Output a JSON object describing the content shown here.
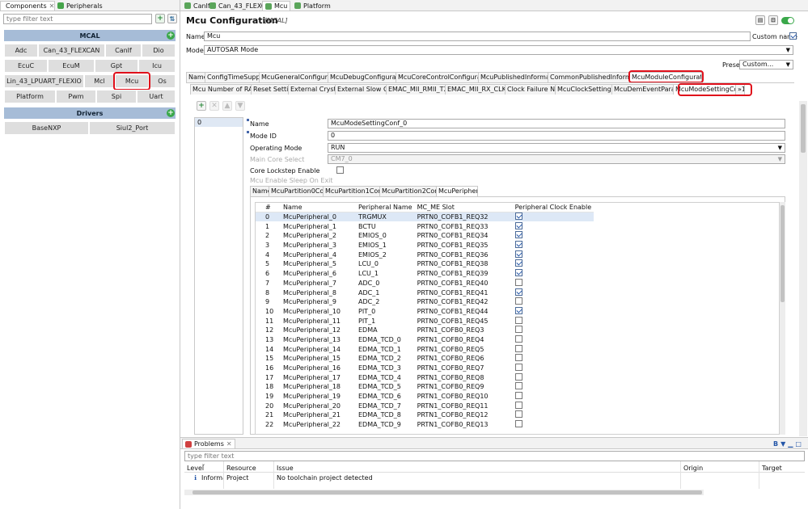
{
  "left_panel": {
    "tabs": [
      "Components",
      "Peripherals"
    ],
    "filter_placeholder": "type filter text",
    "categories": [
      {
        "title": "MCAL",
        "items": [
          "Adc",
          "Can_43_FLEXCAN",
          "CanIf",
          "Dio",
          "EcuC",
          "EcuM",
          "Gpt",
          "Icu",
          "Lin_43_LPUART_FLEXIO",
          "Mcl",
          "Mcu",
          "Os",
          "Platform",
          "Pwm",
          "Spi",
          "Uart"
        ]
      },
      {
        "title": "Drivers",
        "items": [
          "BaseNXP",
          "Siul2_Port"
        ]
      }
    ]
  },
  "editor_tabs": [
    "CanIf",
    "Can_43_FLEXCAN",
    "Mcu",
    "Platform"
  ],
  "header": {
    "title": "Mcu Configuration",
    "subtitle": "[MCAL]"
  },
  "form": {
    "name_label": "Name",
    "name_value": "Mcu",
    "custom_name_label": "Custom name",
    "mode_label": "Mode",
    "mode_value": "AUTOSAR Mode",
    "preset_label": "Preset",
    "preset_value": "Custom..."
  },
  "main_tabs": [
    "Name",
    "ConfigTimeSupport",
    "McuGeneralConfiguration",
    "McuDebugConfiguration",
    "McuCoreControlConfiguration",
    "McuPublishedInformation",
    "CommonPublishedInformation",
    "McuModuleConfiguration"
  ],
  "sub_tabs": [
    "Mcu Number of RAM...",
    "Reset Setting",
    "External Crystal ...",
    "External Slow Cry...",
    "EMAC_MII_RMII_TX_C...",
    "EMAC_MII_RX_CLK E...",
    "Clock Failure Not...",
    "McuClockSettingCo...",
    "McuDemEventParame...",
    "McuModeSettingConf",
    "»1"
  ],
  "list": {
    "items": [
      "0"
    ]
  },
  "mode_form": {
    "name_label": "Name",
    "name_value": "McuModeSettingConf_0",
    "modeid_label": "Mode ID",
    "modeid_value": "0",
    "opmode_label": "Operating Mode",
    "opmode_value": "RUN",
    "maincore_label": "Main Core Select",
    "maincore_value": "CM7_0",
    "lockstep_label": "Core Lockstep Enable",
    "sleep_label": "Mcu Enable Sleep On Exit"
  },
  "inner_tabs": [
    "Name",
    "McuPartition0Config",
    "McuPartition1Config",
    "McuPartition2Config",
    "McuPeripheral"
  ],
  "table": {
    "columns": [
      "#",
      "Name",
      "Peripheral Name",
      "MC_ME Slot",
      "Peripheral Clock Enable"
    ],
    "rows": [
      [
        "0",
        "McuPeripheral_0",
        "TRGMUX",
        "PRTN0_COFB1_REQ32",
        true
      ],
      [
        "1",
        "McuPeripheral_1",
        "BCTU",
        "PRTN0_COFB1_REQ33",
        true
      ],
      [
        "2",
        "McuPeripheral_2",
        "EMIOS_0",
        "PRTN0_COFB1_REQ34",
        true
      ],
      [
        "3",
        "McuPeripheral_3",
        "EMIOS_1",
        "PRTN0_COFB1_REQ35",
        true
      ],
      [
        "4",
        "McuPeripheral_4",
        "EMIOS_2",
        "PRTN0_COFB1_REQ36",
        true
      ],
      [
        "5",
        "McuPeripheral_5",
        "LCU_0",
        "PRTN0_COFB1_REQ38",
        true
      ],
      [
        "6",
        "McuPeripheral_6",
        "LCU_1",
        "PRTN0_COFB1_REQ39",
        true
      ],
      [
        "7",
        "McuPeripheral_7",
        "ADC_0",
        "PRTN0_COFB1_REQ40",
        false
      ],
      [
        "8",
        "McuPeripheral_8",
        "ADC_1",
        "PRTN0_COFB1_REQ41",
        true
      ],
      [
        "9",
        "McuPeripheral_9",
        "ADC_2",
        "PRTN0_COFB1_REQ42",
        false
      ],
      [
        "10",
        "McuPeripheral_10",
        "PIT_0",
        "PRTN0_COFB1_REQ44",
        true
      ],
      [
        "11",
        "McuPeripheral_11",
        "PIT_1",
        "PRTN0_COFB1_REQ45",
        false
      ],
      [
        "12",
        "McuPeripheral_12",
        "EDMA",
        "PRTN1_COFB0_REQ3",
        false
      ],
      [
        "13",
        "McuPeripheral_13",
        "EDMA_TCD_0",
        "PRTN1_COFB0_REQ4",
        false
      ],
      [
        "14",
        "McuPeripheral_14",
        "EDMA_TCD_1",
        "PRTN1_COFB0_REQ5",
        false
      ],
      [
        "15",
        "McuPeripheral_15",
        "EDMA_TCD_2",
        "PRTN1_COFB0_REQ6",
        false
      ],
      [
        "16",
        "McuPeripheral_16",
        "EDMA_TCD_3",
        "PRTN1_COFB0_REQ7",
        false
      ],
      [
        "17",
        "McuPeripheral_17",
        "EDMA_TCD_4",
        "PRTN1_COFB0_REQ8",
        false
      ],
      [
        "18",
        "McuPeripheral_18",
        "EDMA_TCD_5",
        "PRTN1_COFB0_REQ9",
        false
      ],
      [
        "19",
        "McuPeripheral_19",
        "EDMA_TCD_6",
        "PRTN1_COFB0_REQ10",
        false
      ],
      [
        "20",
        "McuPeripheral_20",
        "EDMA_TCD_7",
        "PRTN1_COFB0_REQ11",
        false
      ],
      [
        "21",
        "McuPeripheral_21",
        "EDMA_TCD_8",
        "PRTN1_COFB0_REQ12",
        false
      ],
      [
        "22",
        "McuPeripheral_22",
        "EDMA_TCD_9",
        "PRTN1_COFB0_REQ13",
        false
      ]
    ]
  },
  "problems": {
    "tab": "Problems",
    "filter_placeholder": "type filter text",
    "columns": [
      "Level",
      "Resource",
      "Issue",
      "Origin",
      "Target"
    ],
    "rows": [
      [
        "Informat",
        "Project",
        "No toolchain project detected",
        "",
        ""
      ]
    ]
  }
}
